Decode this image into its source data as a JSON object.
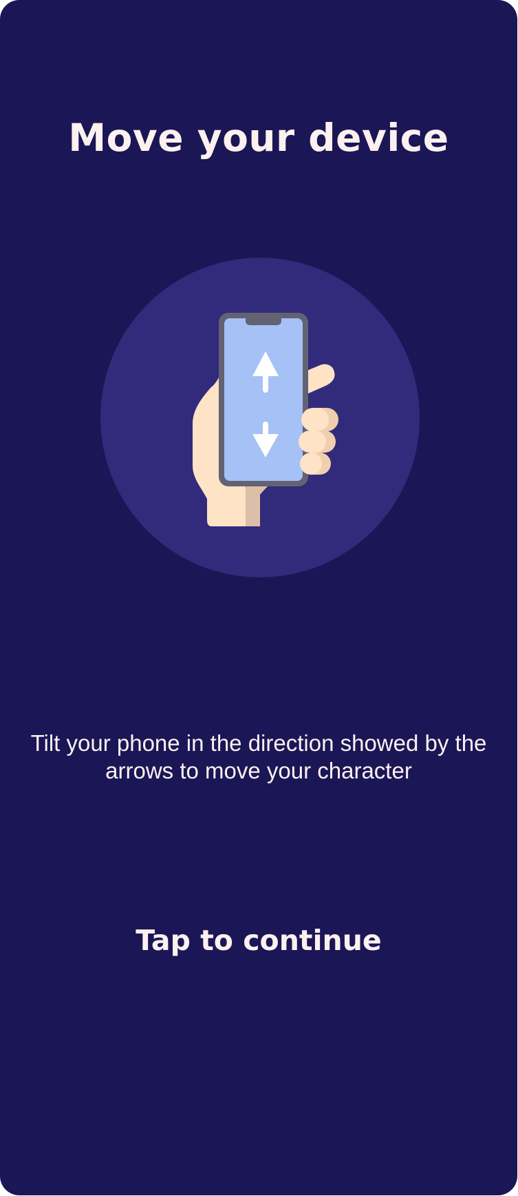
{
  "screen": {
    "title": "Move your device",
    "instructions": "Tilt your phone in the direction showed by the arrows to move your character",
    "continue_label": "Tap to continue"
  },
  "illustration": {
    "icon": "hand-holding-phone-icon",
    "arrows": [
      "arrow-up-icon",
      "arrow-down-icon"
    ]
  },
  "colors": {
    "background": "#1b1655",
    "circle": "#322a7b",
    "text": "#fdf1f0",
    "phone_screen": "#a5c1f6",
    "phone_frame": "#636272",
    "skin": "#fee3c7",
    "skin_shade": "#f0cfae"
  }
}
